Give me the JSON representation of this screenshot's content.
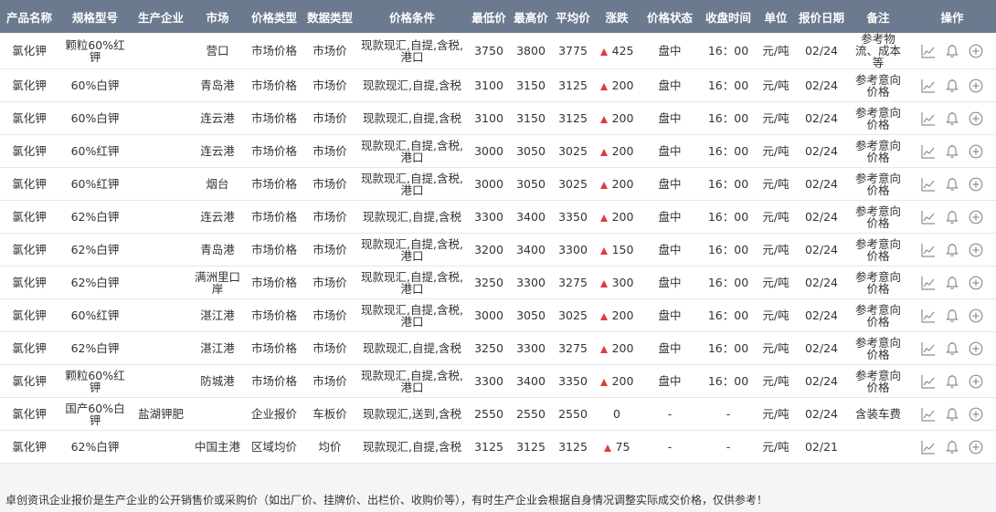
{
  "headers": [
    "产品名称",
    "规格型号",
    "生产企业",
    "市场",
    "价格类型",
    "数据类型",
    "价格条件",
    "最低价",
    "最高价",
    "平均价",
    "涨跌",
    "价格状态",
    "收盘时间",
    "单位",
    "报价日期",
    "备注",
    "操作"
  ],
  "rows": [
    {
      "product": "氯化钾",
      "spec": "颗粒60%红钾",
      "producer": "",
      "market": "营口",
      "price_type": "市场价格",
      "data_type": "市场价",
      "condition": "现款现汇,自提,含税,港口",
      "low": "3750",
      "high": "3800",
      "avg": "3775",
      "change": "425",
      "change_dir": "up",
      "status": "盘中",
      "close_time": "16：00",
      "unit": "元/吨",
      "date": "02/24",
      "remark": "参考物流、成本等"
    },
    {
      "product": "氯化钾",
      "spec": "60%白钾",
      "producer": "",
      "market": "青岛港",
      "price_type": "市场价格",
      "data_type": "市场价",
      "condition": "现款现汇,自提,含税",
      "low": "3100",
      "high": "3150",
      "avg": "3125",
      "change": "200",
      "change_dir": "up",
      "status": "盘中",
      "close_time": "16：00",
      "unit": "元/吨",
      "date": "02/24",
      "remark": "参考意向价格"
    },
    {
      "product": "氯化钾",
      "spec": "60%白钾",
      "producer": "",
      "market": "连云港",
      "price_type": "市场价格",
      "data_type": "市场价",
      "condition": "现款现汇,自提,含税",
      "low": "3100",
      "high": "3150",
      "avg": "3125",
      "change": "200",
      "change_dir": "up",
      "status": "盘中",
      "close_time": "16：00",
      "unit": "元/吨",
      "date": "02/24",
      "remark": "参考意向价格"
    },
    {
      "product": "氯化钾",
      "spec": "60%红钾",
      "producer": "",
      "market": "连云港",
      "price_type": "市场价格",
      "data_type": "市场价",
      "condition": "现款现汇,自提,含税,港口",
      "low": "3000",
      "high": "3050",
      "avg": "3025",
      "change": "200",
      "change_dir": "up",
      "status": "盘中",
      "close_time": "16：00",
      "unit": "元/吨",
      "date": "02/24",
      "remark": "参考意向价格"
    },
    {
      "product": "氯化钾",
      "spec": "60%红钾",
      "producer": "",
      "market": "烟台",
      "price_type": "市场价格",
      "data_type": "市场价",
      "condition": "现款现汇,自提,含税,港口",
      "low": "3000",
      "high": "3050",
      "avg": "3025",
      "change": "200",
      "change_dir": "up",
      "status": "盘中",
      "close_time": "16：00",
      "unit": "元/吨",
      "date": "02/24",
      "remark": "参考意向价格"
    },
    {
      "product": "氯化钾",
      "spec": "62%白钾",
      "producer": "",
      "market": "连云港",
      "price_type": "市场价格",
      "data_type": "市场价",
      "condition": "现款现汇,自提,含税",
      "low": "3300",
      "high": "3400",
      "avg": "3350",
      "change": "200",
      "change_dir": "up",
      "status": "盘中",
      "close_time": "16：00",
      "unit": "元/吨",
      "date": "02/24",
      "remark": "参考意向价格"
    },
    {
      "product": "氯化钾",
      "spec": "62%白钾",
      "producer": "",
      "market": "青岛港",
      "price_type": "市场价格",
      "data_type": "市场价",
      "condition": "现款现汇,自提,含税,港口",
      "low": "3200",
      "high": "3400",
      "avg": "3300",
      "change": "150",
      "change_dir": "up",
      "status": "盘中",
      "close_time": "16：00",
      "unit": "元/吨",
      "date": "02/24",
      "remark": "参考意向价格"
    },
    {
      "product": "氯化钾",
      "spec": "62%白钾",
      "producer": "",
      "market": "满洲里口岸",
      "price_type": "市场价格",
      "data_type": "市场价",
      "condition": "现款现汇,自提,含税,港口",
      "low": "3250",
      "high": "3300",
      "avg": "3275",
      "change": "300",
      "change_dir": "up",
      "status": "盘中",
      "close_time": "16：00",
      "unit": "元/吨",
      "date": "02/24",
      "remark": "参考意向价格"
    },
    {
      "product": "氯化钾",
      "spec": "60%红钾",
      "producer": "",
      "market": "湛江港",
      "price_type": "市场价格",
      "data_type": "市场价",
      "condition": "现款现汇,自提,含税,港口",
      "low": "3000",
      "high": "3050",
      "avg": "3025",
      "change": "200",
      "change_dir": "up",
      "status": "盘中",
      "close_time": "16：00",
      "unit": "元/吨",
      "date": "02/24",
      "remark": "参考意向价格"
    },
    {
      "product": "氯化钾",
      "spec": "62%白钾",
      "producer": "",
      "market": "湛江港",
      "price_type": "市场价格",
      "data_type": "市场价",
      "condition": "现款现汇,自提,含税",
      "low": "3250",
      "high": "3300",
      "avg": "3275",
      "change": "200",
      "change_dir": "up",
      "status": "盘中",
      "close_time": "16：00",
      "unit": "元/吨",
      "date": "02/24",
      "remark": "参考意向价格"
    },
    {
      "product": "氯化钾",
      "spec": "颗粒60%红钾",
      "producer": "",
      "market": "防城港",
      "price_type": "市场价格",
      "data_type": "市场价",
      "condition": "现款现汇,自提,含税,港口",
      "low": "3300",
      "high": "3400",
      "avg": "3350",
      "change": "200",
      "change_dir": "up",
      "status": "盘中",
      "close_time": "16：00",
      "unit": "元/吨",
      "date": "02/24",
      "remark": "参考意向价格"
    },
    {
      "product": "氯化钾",
      "spec": "国产60%白钾",
      "producer": "盐湖钾肥",
      "market": "",
      "price_type": "企业报价",
      "data_type": "车板价",
      "condition": "现款现汇,送到,含税",
      "low": "2550",
      "high": "2550",
      "avg": "2550",
      "change": "0",
      "change_dir": "none",
      "status": "-",
      "close_time": "-",
      "unit": "元/吨",
      "date": "02/24",
      "remark": "含装车费"
    },
    {
      "product": "氯化钾",
      "spec": "62%白钾",
      "producer": "",
      "market": "中国主港",
      "price_type": "区域均价",
      "data_type": "均价",
      "condition": "现款现汇,自提,含税",
      "low": "3125",
      "high": "3125",
      "avg": "3125",
      "change": "75",
      "change_dir": "up",
      "status": "-",
      "close_time": "-",
      "unit": "元/吨",
      "date": "02/21",
      "remark": ""
    }
  ],
  "footnote": "卓创资讯企业报价是生产企业的公开销售价或采购价（如出厂价、挂牌价、出栏价、收购价等），有时生产企业会根据自身情况调整实际成交价格，仅供参考！",
  "icons": [
    "chart-icon",
    "bell-icon",
    "add-icon"
  ],
  "colors": {
    "header_bg": "#6b7a8f",
    "up": "#e4393c"
  }
}
